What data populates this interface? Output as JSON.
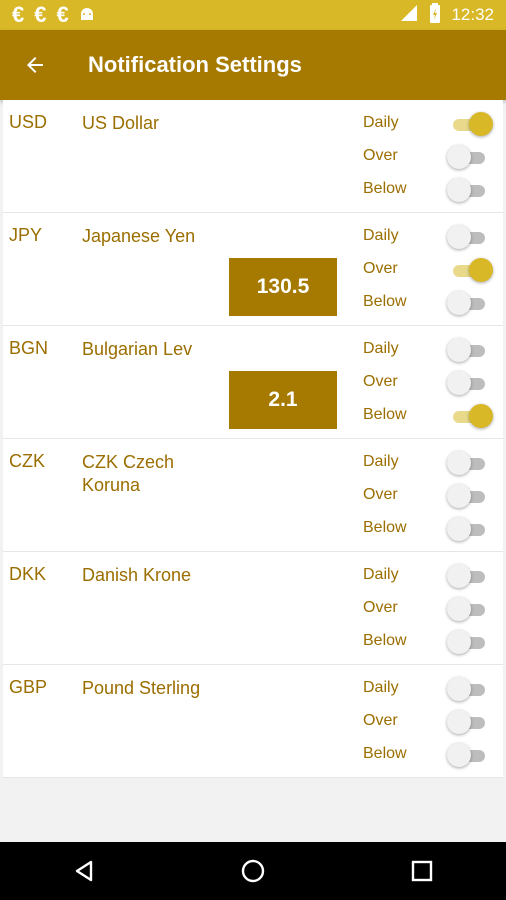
{
  "status_bar": {
    "time": "12:32",
    "left_icons": [
      "€",
      "€",
      "€"
    ]
  },
  "app_bar": {
    "title": "Notification Settings"
  },
  "labels": {
    "daily": "Daily",
    "over": "Over",
    "below": "Below"
  },
  "currencies": [
    {
      "code": "USD",
      "name": "US Dollar",
      "value": "",
      "daily": true,
      "over": false,
      "below": false
    },
    {
      "code": "JPY",
      "name": "Japanese Yen",
      "value": "130.5",
      "daily": false,
      "over": true,
      "below": false
    },
    {
      "code": "BGN",
      "name": "Bulgarian Lev",
      "value": "2.1",
      "daily": false,
      "over": false,
      "below": true
    },
    {
      "code": "CZK",
      "name": "CZK Czech Koruna",
      "value": "",
      "daily": false,
      "over": false,
      "below": false
    },
    {
      "code": "DKK",
      "name": "Danish Krone",
      "value": "",
      "daily": false,
      "over": false,
      "below": false
    },
    {
      "code": "GBP",
      "name": "Pound Sterling",
      "value": "",
      "daily": false,
      "over": false,
      "below": false
    }
  ],
  "colors": {
    "status_bar": "#d8b826",
    "app_bar": "#a67a00",
    "text": "#9b6e00",
    "toggle_on": "#d8b826"
  }
}
